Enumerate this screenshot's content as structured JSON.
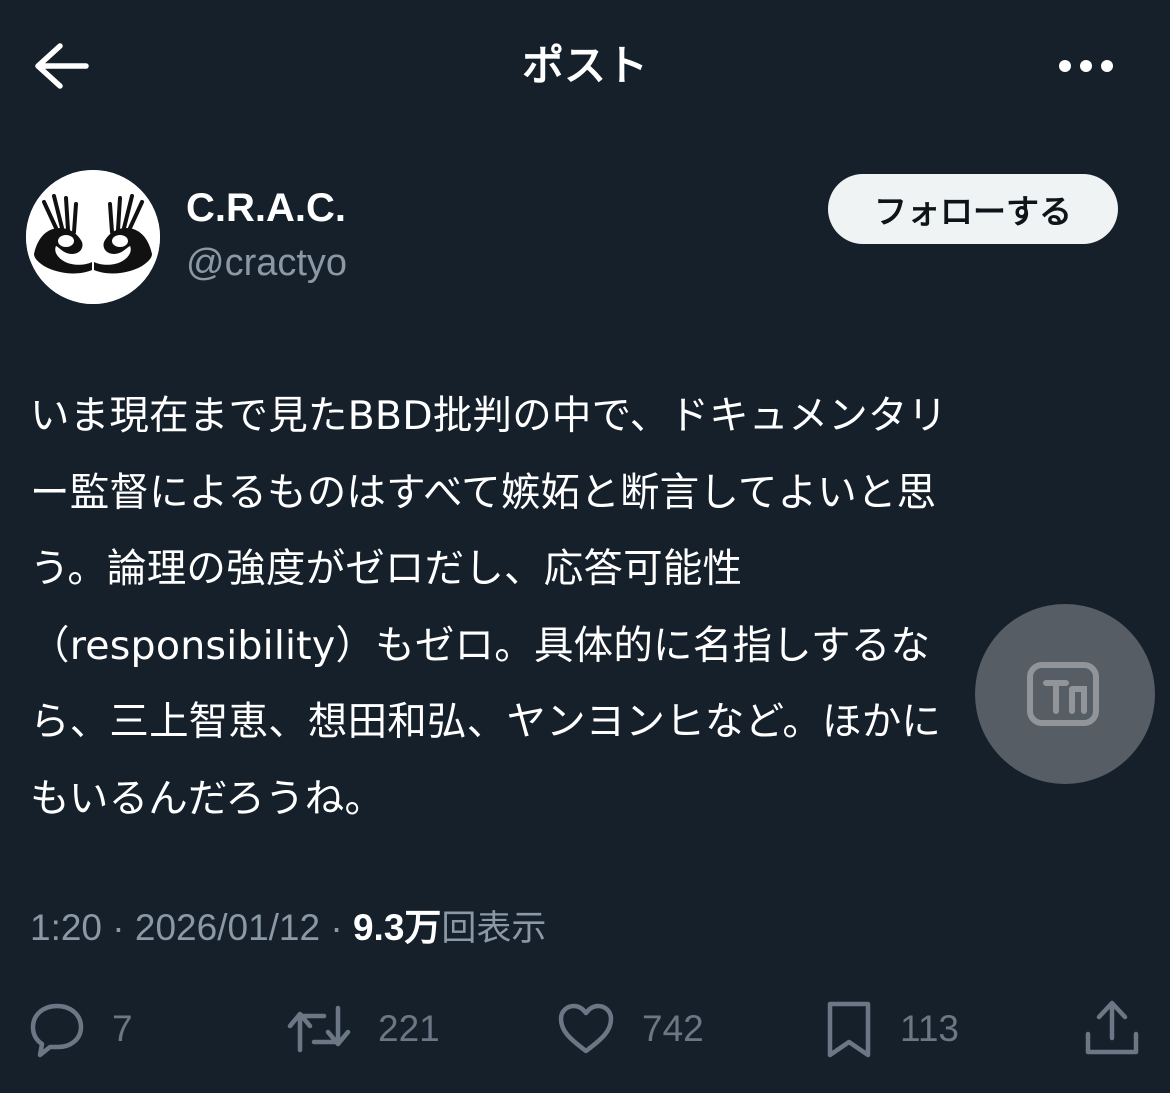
{
  "header": {
    "title": "ポスト"
  },
  "author": {
    "display_name": "C.R.A.C.",
    "handle": "@cractyo",
    "follow_label": "フォローする"
  },
  "tweet": {
    "lines": [
      "いま現在まで見たBBD批判の中で、ドキュメンタリ",
      "ー監督によるものはすべて嫉妬と断言してよいと思",
      "う。論理の強度がゼロだし、応答可能性",
      "（responsibility）もゼロ。具体的に名指しするな",
      "ら、三上智恵、想田和弘、ヤンヨンヒなど。ほかに",
      "もいるんだろうね。"
    ]
  },
  "meta": {
    "time": "1:20",
    "separator": "·",
    "date": "2026/01/12",
    "views_count": "9.3万",
    "views_label": "回表示"
  },
  "actions": {
    "reply_count": "7",
    "repost_count": "221",
    "like_count": "742",
    "bookmark_count": "113"
  },
  "colors": {
    "background": "#15202b",
    "muted": "#8b98a5",
    "button_bg": "#eff3f4"
  },
  "icons": {
    "back": "arrow-left-icon",
    "more": "more-dots-icon",
    "reply": "comment-icon",
    "repost": "repost-icon",
    "like": "heart-icon",
    "bookmark": "bookmark-icon",
    "share": "share-icon"
  }
}
